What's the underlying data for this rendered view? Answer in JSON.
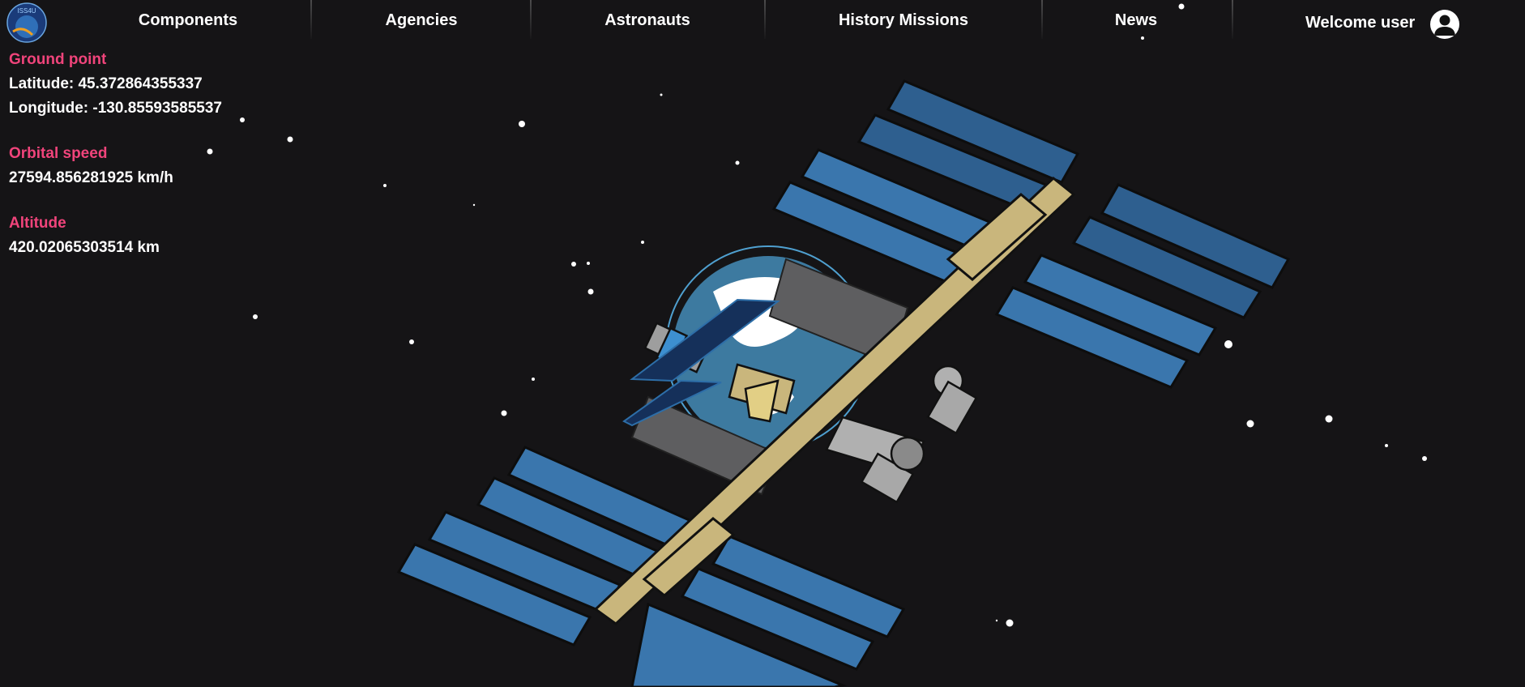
{
  "nav": {
    "items": [
      {
        "label": "Components"
      },
      {
        "label": "Agencies"
      },
      {
        "label": "Astronauts"
      },
      {
        "label": "History Missions"
      },
      {
        "label": "News"
      }
    ],
    "welcome_text": "Welcome user",
    "logo_text": "ISS4U"
  },
  "telemetry": {
    "ground_point": {
      "label": "Ground point",
      "latitude": "Latitude: 45.372864355337",
      "longitude": "Longitude: -130.85593585537"
    },
    "orbital_speed": {
      "label": "Orbital speed",
      "value": "27594.856281925 km/h"
    },
    "altitude": {
      "label": "Altitude",
      "value": "420.02065303514 km"
    }
  },
  "colors": {
    "background": "#151416",
    "accent_label": "#f0447b",
    "solar_panel": "#3a76ad",
    "truss": "#c9b67c"
  },
  "icons": {
    "avatar": "user-icon",
    "logo": "iss4u-logo"
  }
}
